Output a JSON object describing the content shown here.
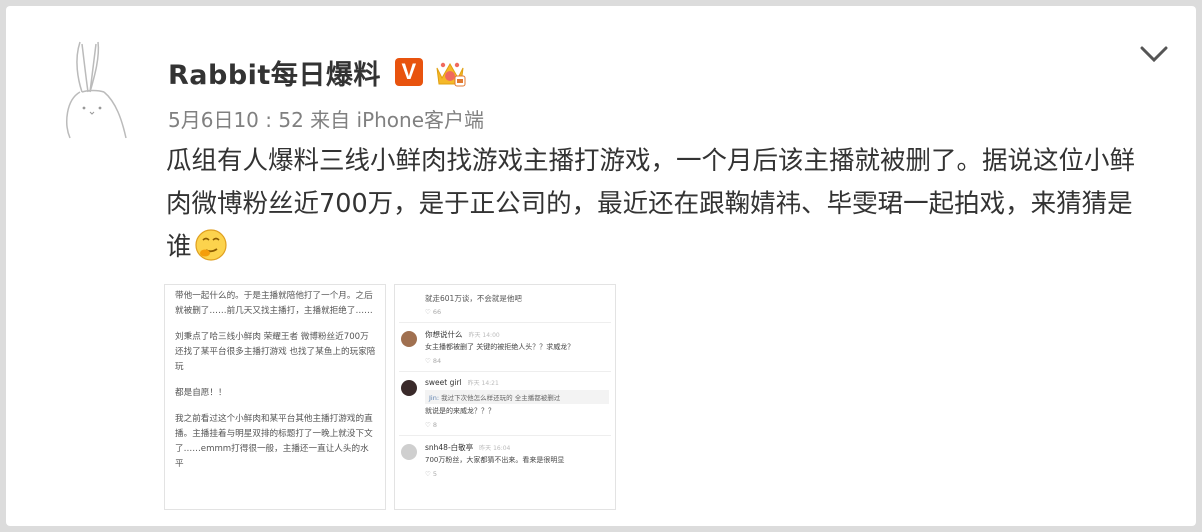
{
  "post": {
    "author": "Rabbit每日爆料",
    "vip_badge": "V",
    "meta": "5月6日10 : 52 来自 iPhone客户端",
    "text": "瓜组有人爆料三线小鲜肉找游戏主播打游戏，一个月后该主播就被删了。据说这位小鲜肉微博粉丝近700万，是于正公司的，最近还在跟鞠婧祎、毕雯珺一起拍戏，来猜猜是谁"
  },
  "images": [
    {
      "paragraphs": [
        "带他一起什么的。于是主播就陪他打了一个月。之后就被删了……前几天又找主播打，主播就拒绝了……",
        "刘秉点了哈三线小鲜肉 荣耀王者 微博粉丝近700万 还找了某平台很多主播打游戏 也找了某鱼上的玩家陪玩",
        "都是自愿！！",
        "我之前看过这个小鲜肉和某平台其他主播打游戏的直播。主播挂着与明星双排的标题打了一晚上就没下文了……emmm打得很一般，主播还一直让人头的水平"
      ]
    },
    {
      "top_text": "就走601万谈，不会就是他吧",
      "top_likes": "66",
      "comments": [
        {
          "name": "你想说什么",
          "time": "昨天 14:00",
          "text": "女主播都被删了 关键的被拒绝人头？？求威龙？",
          "likes": "84"
        },
        {
          "name": "sweet girl",
          "time": "昨天 14:21",
          "quote_name": "Jin:",
          "quote": "我过下次他怎么样还玩的 全主播都被删过",
          "text": "就说是的来威龙？？？",
          "likes": "8"
        },
        {
          "name": "snh48-白敬亭",
          "time": "昨天 16:04",
          "text": "700万粉丝，大家都猜不出来。看来是很明显",
          "likes": "5"
        }
      ]
    }
  ]
}
